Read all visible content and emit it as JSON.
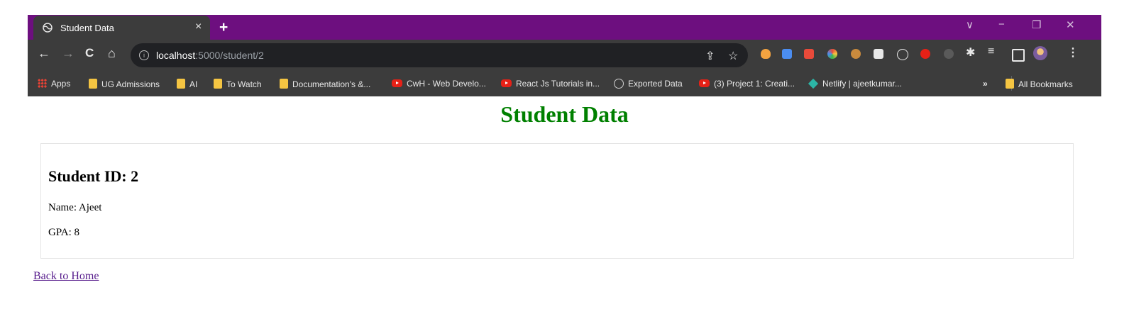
{
  "browser": {
    "tab_title": "Student Data",
    "tab_close": "×",
    "new_tab": "+",
    "window_controls": {
      "dropdown": "∨",
      "minimize": "−",
      "restore": "❐",
      "close": "✕"
    },
    "nav": {
      "back": "←",
      "forward": "→",
      "reload": "C",
      "home": "⌂"
    },
    "url_host": "localhost",
    "url_path": ":5000/student/2",
    "menu": "⋮",
    "theme_color": "#6d0f7f",
    "bookmarks": [
      {
        "label": "Apps",
        "icon": "apps-grid-icon"
      },
      {
        "label": "UG Admissions",
        "icon": "folder-icon"
      },
      {
        "label": "AI",
        "icon": "folder-icon"
      },
      {
        "label": "To Watch",
        "icon": "folder-icon"
      },
      {
        "label": "Documentation's &...",
        "icon": "folder-icon"
      },
      {
        "label": "CwH - Web Develo...",
        "icon": "youtube-icon"
      },
      {
        "label": "React Js Tutorials in...",
        "icon": "youtube-icon"
      },
      {
        "label": "Exported Data",
        "icon": "globe-icon"
      },
      {
        "label": "(3) Project 1: Creati...",
        "icon": "youtube-icon"
      },
      {
        "label": "Netlify | ajeetkumar...",
        "icon": "netlify-icon"
      }
    ],
    "bookmarks_overflow": "»",
    "all_bookmarks": "All Bookmarks"
  },
  "page": {
    "heading": "Student Data",
    "student_id": "Student ID: 2",
    "name": "Name: Ajeet",
    "gpa": "GPA: 8",
    "back_link": "Back to Home",
    "heading_color": "#008000",
    "link_color": "#551a8b"
  }
}
